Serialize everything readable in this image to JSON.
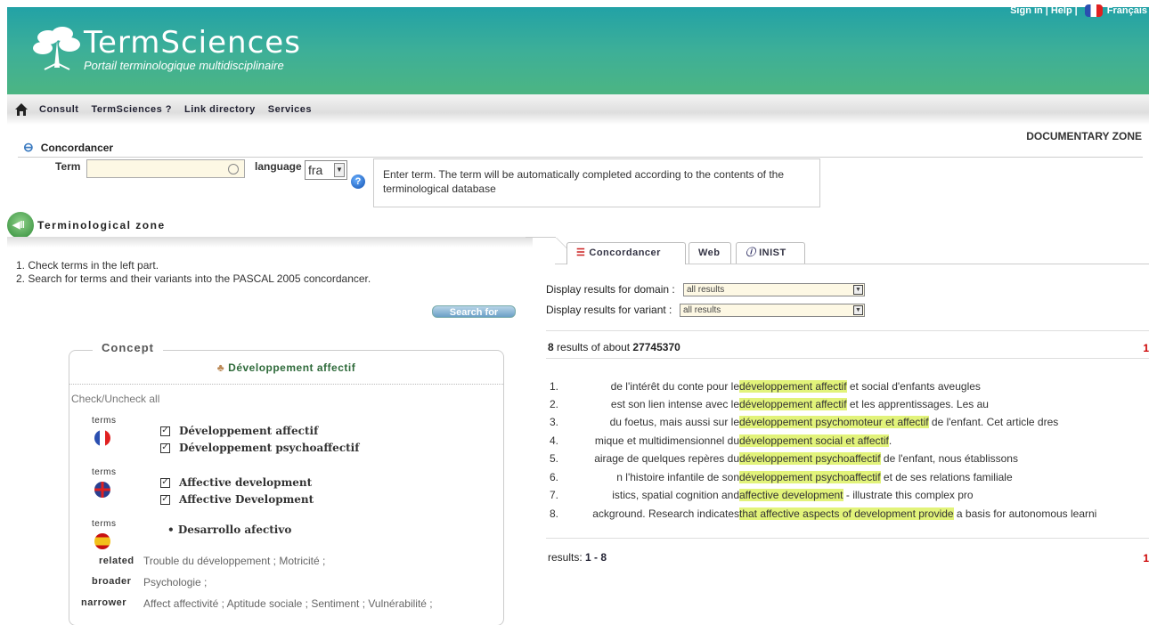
{
  "header": {
    "logo_title": "TermSciences",
    "logo_subtitle": "Portail terminologique multidisciplinaire",
    "sign_in": "Sign in",
    "help": "Help",
    "language": "Français"
  },
  "nav": {
    "items": [
      "Consult",
      "TermSciences ?",
      "Link directory",
      "Services"
    ]
  },
  "concordancer": {
    "title": "Concordancer",
    "documentary_zone": "DOCUMENTARY ZONE",
    "term_label": "Term",
    "term_value": "",
    "language_label": "language",
    "language_value": "fra",
    "tooltip": "Enter term. The term will be automatically completed according to the contents of the terminological database"
  },
  "terminological_zone": {
    "label": "Terminological zone",
    "instructions": [
      "1.  Check terms in the left part.",
      "2.  Search for terms and their variants into the PASCAL 2005 concordancer."
    ],
    "search_button": "Search for"
  },
  "concept": {
    "legend": "Concept",
    "title": "Développement affectif",
    "check_all": "Check/Uncheck all",
    "terms_label": "terms",
    "fr_terms": [
      "Développement affectif",
      "Développement psychoaffectif"
    ],
    "en_terms": [
      "Affective development",
      "Affective Development"
    ],
    "es_terms": [
      "Desarrollo afectivo"
    ],
    "related_label": "related",
    "related_value": "Trouble du développement ; Motricité ;",
    "broader_label": "broader",
    "broader_value": "Psychologie ;",
    "narrower_label": "narrower",
    "narrower_value": "Affect affectivité ; Aptitude sociale ; Sentiment ; Vulnérabilité ;"
  },
  "tabs": [
    "Concordancer",
    "Web",
    "INIST"
  ],
  "filters": {
    "domain_label": "Display results for domain :",
    "domain_value": "all results",
    "variant_label": "Display results for variant :",
    "variant_value": "all results"
  },
  "results": {
    "count": "8",
    "count_text": " results of about ",
    "total": "27745370",
    "page_marker": "1",
    "rows": [
      {
        "n": "1.",
        "left": "de l'intérêt du conte pour le ",
        "hl": "développement affectif",
        "right": " et social d'enfants aveugles"
      },
      {
        "n": "2.",
        "left": "est son lien intense avec le ",
        "hl": "développement affectif",
        "right": " et les apprentissages. Les au"
      },
      {
        "n": "3.",
        "left": "du foetus, mais aussi sur le ",
        "hl": "développement psychomoteur et affectif",
        "right": " de l'enfant. Cet article dres"
      },
      {
        "n": "4.",
        "left": "mique et multidimensionnel du ",
        "hl": "développement social et affectif",
        "right": "."
      },
      {
        "n": "5.",
        "left": "airage de quelques repères du ",
        "hl": "développement psychoaffectif",
        "right": " de l'enfant, nous établissons"
      },
      {
        "n": "6.",
        "left": "n l'histoire infantile de son ",
        "hl": "développement psychoaffectif",
        "right": " et de ses relations familiale"
      },
      {
        "n": "7.",
        "left": "istics, spatial cognition and ",
        "hl": "affective development",
        "right": " - illustrate this complex pro"
      },
      {
        "n": "8.",
        "left": "ackground. Research indicates ",
        "hl": "that affective aspects of development provide",
        "right": " a basis for autonomous learni"
      }
    ],
    "footer_label": "results: ",
    "footer_range": "1 - 8"
  }
}
